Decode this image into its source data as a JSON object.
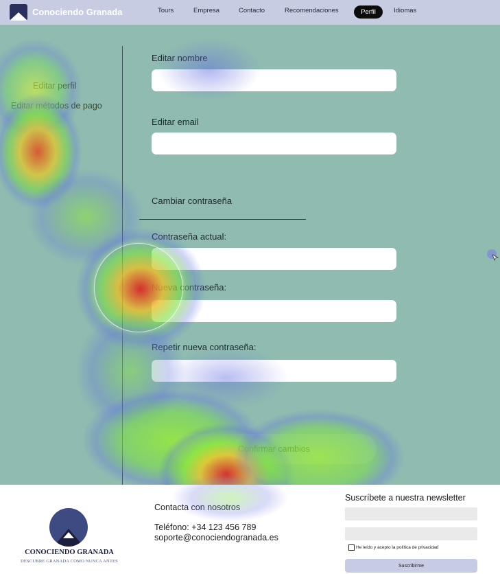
{
  "header": {
    "brand": "Conociendo Granada",
    "nav": [
      "Tours",
      "Empresa",
      "Contacto",
      "Recomendaciones",
      "Perfil",
      "Idiomas"
    ],
    "active_nav": "Perfil"
  },
  "sidebar": {
    "items": [
      "Editar perfil",
      "Editar métodos de pago"
    ]
  },
  "form": {
    "name_label": "Editar nombre",
    "name_value": "",
    "email_label": "Editar email",
    "email_value": "",
    "password_section": "Cambiar contraseña",
    "current_password_label": "Contraseña actual:",
    "new_password_label": "Nueva contraseña:",
    "repeat_password_label": "Repetir nueva contraseña:",
    "confirm_button": "Confirmar cambios"
  },
  "footer": {
    "brand": "CONOCIENDO GRANADA",
    "tagline": "DESCUBRE GRANADA COMO NUNCA ANTES",
    "contact_title": "Contacta con nosotros",
    "phone": "Teléfono: +34 123 456 789",
    "email": "soporte@conociendogranada.es",
    "newsletter_title": "Suscríbete a nuestra newsletter",
    "privacy_text": "He leído y acepto la política de privacidad",
    "subscribe_button": "Suscribirme"
  },
  "colors": {
    "header_bg": "#c8cce3",
    "main_bg": "#8fbbb0",
    "active_pill": "#0c0c0c",
    "subscribe_bg": "#c7cbe4"
  },
  "icons": [
    "logo-icon",
    "mountain-logo-icon",
    "cursor-icon",
    "checkbox-icon"
  ]
}
